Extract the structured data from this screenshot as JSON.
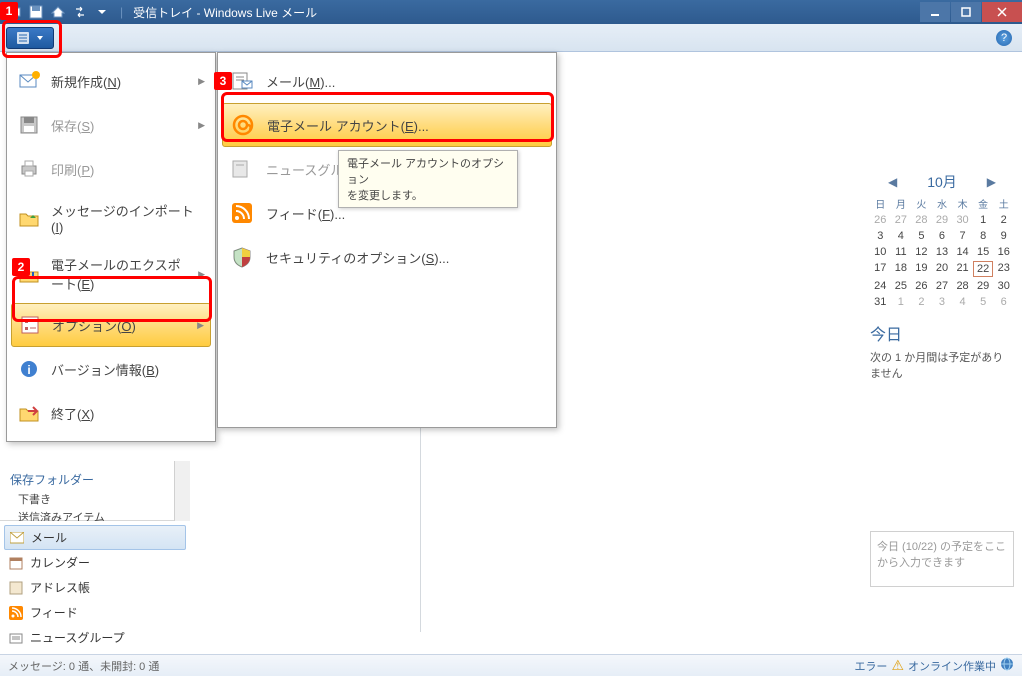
{
  "titlebar": {
    "title": "受信トレイ - Windows Live メール"
  },
  "filemenu": {
    "new_label": "新規作成(N)",
    "save_label": "保存(S)",
    "print_label": "印刷(P)",
    "import_label": "メッセージのインポート(I)",
    "export_label": "電子メールのエクスポート(E)",
    "options_label": "オプション(O)",
    "about_label": "バージョン情報(B)",
    "exit_label": "終了(X)"
  },
  "submenu": {
    "mail_label": "メール(M)...",
    "account_label": "電子メール アカウント(E)...",
    "newsgroup_label": "ニュースグループ",
    "feed_label": "フィード(F)...",
    "security_label": "セキュリティのオプション(S)..."
  },
  "tooltip": {
    "line1": "電子メール アカウントのオプション",
    "line2": "を変更します。"
  },
  "sidebar_folders": {
    "title": "保存フォルダー",
    "drafts": "下書き",
    "sent": "送信済みアイテム"
  },
  "sidebar_nav": {
    "mail": "メール",
    "calendar": "カレンダー",
    "contacts": "アドレス帳",
    "feed": "フィード",
    "newsgroup": "ニュースグループ"
  },
  "calendar": {
    "month": "10月",
    "day_heads": [
      "日",
      "月",
      "火",
      "水",
      "木",
      "金",
      "土"
    ],
    "weeks": [
      [
        "26",
        "27",
        "28",
        "29",
        "30",
        "1",
        "2"
      ],
      [
        "3",
        "4",
        "5",
        "6",
        "7",
        "8",
        "9"
      ],
      [
        "10",
        "11",
        "12",
        "13",
        "14",
        "15",
        "16"
      ],
      [
        "17",
        "18",
        "19",
        "20",
        "21",
        "22",
        "23"
      ],
      [
        "24",
        "25",
        "26",
        "27",
        "28",
        "29",
        "30"
      ],
      [
        "31",
        "1",
        "2",
        "3",
        "4",
        "5",
        "6"
      ]
    ],
    "today_day": "22"
  },
  "today_section": {
    "title": "今日",
    "text": "次の 1 か月間は予定がありません",
    "placeholder": "今日 (10/22) の予定をここから入力できます"
  },
  "statusbar": {
    "left": "メッセージ: 0 通、未開封: 0 通",
    "error": "エラー",
    "online": "オンライン作業中"
  },
  "callouts": {
    "b1": "1",
    "b2": "2",
    "b3": "3"
  }
}
